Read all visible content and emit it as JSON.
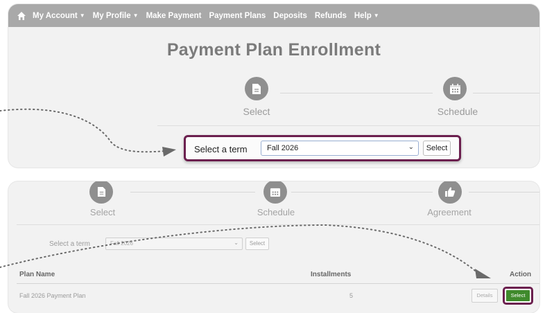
{
  "nav": {
    "items": [
      {
        "label": "My Account",
        "caret": true
      },
      {
        "label": "My Profile",
        "caret": true
      },
      {
        "label": "Make Payment",
        "caret": false
      },
      {
        "label": "Payment Plans",
        "caret": false
      },
      {
        "label": "Deposits",
        "caret": false
      },
      {
        "label": "Refunds",
        "caret": false
      },
      {
        "label": "Help",
        "caret": true
      }
    ]
  },
  "top": {
    "title": "Payment Plan Enrollment",
    "steps": {
      "select": "Select",
      "schedule": "Schedule"
    },
    "term_label": "Select a term",
    "term_value": "Fall 2026",
    "select_button": "Select"
  },
  "bottom": {
    "steps": {
      "select": "Select",
      "schedule": "Schedule",
      "agreement": "Agreement"
    },
    "term_label": "Select a term",
    "term_value": "Fall 2026",
    "select_button": "Select",
    "table": {
      "headers": {
        "plan_name": "Plan Name",
        "installments": "Installments",
        "action": "Action"
      },
      "rows": [
        {
          "plan_name": "Fall 2026 Payment Plan",
          "installments": "5",
          "details": "Details",
          "select": "Select"
        }
      ]
    }
  },
  "colors": {
    "nav_bg": "#a9a9a9",
    "highlight_border": "#6b1f4e",
    "select_green": "#3f8a2c",
    "step_circle": "#8f8f8f"
  },
  "icons": [
    "home-icon",
    "document-icon",
    "calendar-icon",
    "thumbs-up-icon",
    "chevron-down-icon",
    "arrow-icon"
  ]
}
